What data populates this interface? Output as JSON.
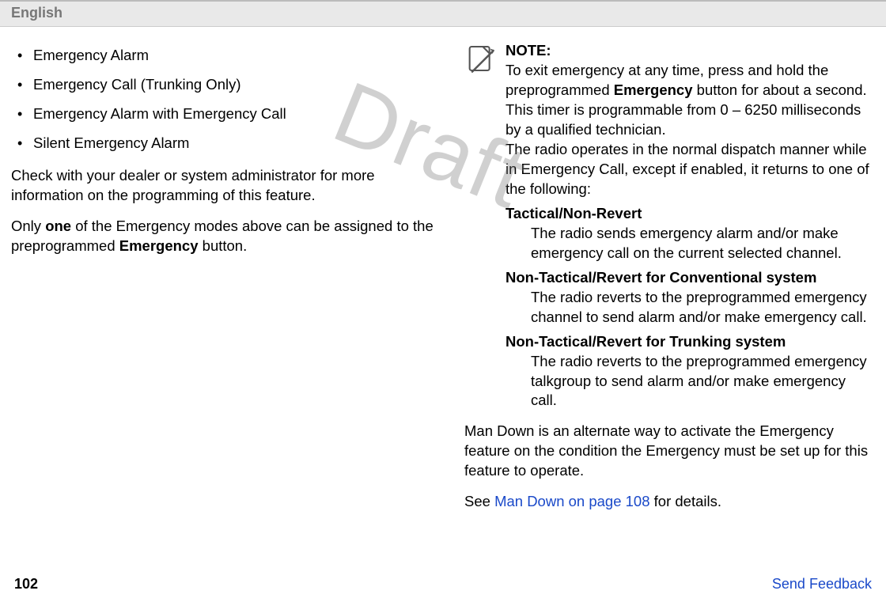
{
  "header": {
    "language": "English"
  },
  "watermark": "Draft",
  "left": {
    "bullets": [
      "Emergency Alarm",
      "Emergency Call (Trunking Only)",
      "Emergency Alarm with Emergency Call",
      "Silent Emergency Alarm"
    ],
    "para1": "Check with your dealer or system administrator for more information on the programming of this feature.",
    "para2_pre": "Only ",
    "para2_bold1": "one",
    "para2_mid": " of the Emergency modes above can be assigned to the preprogrammed ",
    "para2_bold2": "Emergency",
    "para2_post": " button."
  },
  "right": {
    "note_label": "NOTE:",
    "note_p1_pre": "To exit emergency at any time, press and hold the preprogrammed ",
    "note_p1_bold": "Emergency",
    "note_p1_post": " button for about a second. This timer is programmable from 0 – 6250 milliseconds by a qualified technician.",
    "note_p2": "The radio operates in the normal dispatch manner while in Emergency Call, except if enabled, it returns to one of the following:",
    "dl": [
      {
        "term": "Tactical/Non-Revert",
        "def": "The radio sends emergency alarm and/or make emergency call on the current selected channel."
      },
      {
        "term": "Non-Tactical/Revert for Conventional system",
        "def": "The radio reverts to the preprogrammed emergency channel to send alarm and/or make emergency call."
      },
      {
        "term": "Non-Tactical/Revert for Trunking system",
        "def": "The radio reverts to the preprogrammed emergency talkgroup to send alarm and/or make emergency call."
      }
    ],
    "para_mandown": "Man Down is an alternate way to activate the Emergency feature on the condition the Emergency must be set up for this feature to operate.",
    "see_pre": "See ",
    "see_link": "Man Down on page 108",
    "see_post": " for details."
  },
  "footer": {
    "page_number": "102",
    "feedback": "Send Feedback"
  }
}
